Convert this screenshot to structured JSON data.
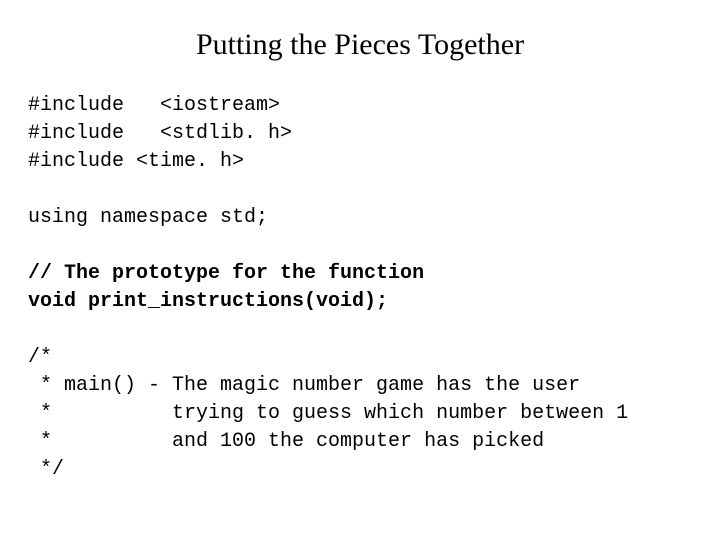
{
  "title": "Putting the Pieces Together",
  "code": {
    "l1": "#include   <iostream>",
    "l2": "#include   <stdlib. h>",
    "l3": "#include <time. h>",
    "gap1": "",
    "l4": "using namespace std;",
    "gap2": "",
    "l5": "// The prototype for the function",
    "l6": "void print_instructions(void);",
    "gap3": "",
    "l7": "/*",
    "l8": " * main() - The magic number game has the user",
    "l9": " *          trying to guess which number between 1",
    "l10": " *          and 100 the computer has picked",
    "l11": " */"
  }
}
